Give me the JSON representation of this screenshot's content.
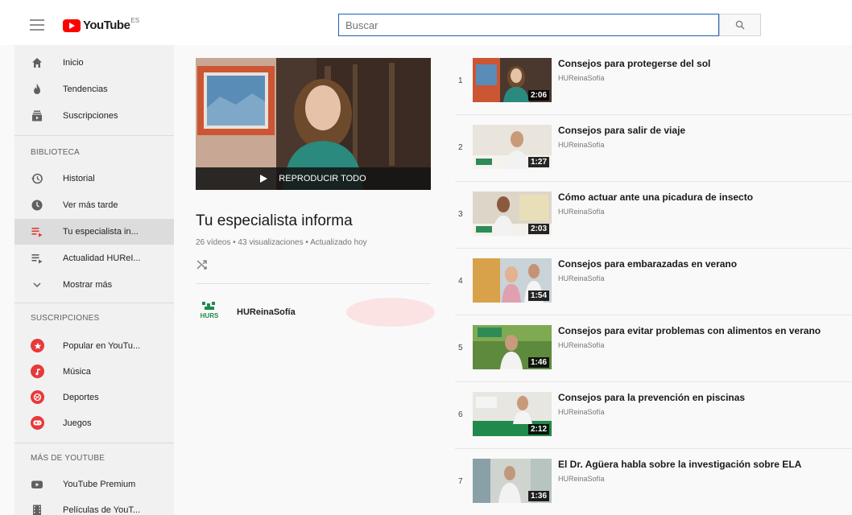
{
  "header": {
    "logo_text": "YouTube",
    "country": "ES",
    "search_placeholder": "Buscar"
  },
  "sidebar": {
    "main": [
      {
        "label": "Inicio",
        "icon": "home-icon"
      },
      {
        "label": "Tendencias",
        "icon": "flame-icon"
      },
      {
        "label": "Suscripciones",
        "icon": "subscriptions-icon"
      }
    ],
    "library_title": "BIBLIOTECA",
    "library": [
      {
        "label": "Historial",
        "icon": "history-icon"
      },
      {
        "label": "Ver más tarde",
        "icon": "clock-icon"
      },
      {
        "label": "Tu especialista in...",
        "icon": "playlist-icon",
        "active": true
      },
      {
        "label": "Actualidad HUReI...",
        "icon": "playlist-icon"
      },
      {
        "label": "Mostrar más",
        "icon": "chevron-down-icon"
      }
    ],
    "subs_title": "SUSCRIPCIONES",
    "subs": [
      {
        "label": "Popular en YouTu...",
        "icon": "star-icon"
      },
      {
        "label": "Música",
        "icon": "music-icon"
      },
      {
        "label": "Deportes",
        "icon": "sports-icon"
      },
      {
        "label": "Juegos",
        "icon": "gamepad-icon"
      }
    ],
    "more_title": "MÁS DE YOUTUBE",
    "more": [
      {
        "label": "YouTube Premium",
        "icon": "youtube-icon"
      },
      {
        "label": "Películas de YouT...",
        "icon": "film-icon"
      }
    ]
  },
  "playlist": {
    "play_all": "REPRODUCIR TODO",
    "title": "Tu especialista informa",
    "stats": "26 vídeos • 43 visualizaciones • Actualizado hoy",
    "owner": "HUReinaSofía",
    "owner_logo_text": "HURS"
  },
  "videos": [
    {
      "index": "1",
      "title": "Consejos para protegerse del sol",
      "channel": "HUReinaSofía",
      "duration": "2:06"
    },
    {
      "index": "2",
      "title": "Consejos para salir de viaje",
      "channel": "HUReinaSofía",
      "duration": "1:27"
    },
    {
      "index": "3",
      "title": "Cómo actuar ante una picadura de insecto",
      "channel": "HUReinaSofía",
      "duration": "2:03"
    },
    {
      "index": "4",
      "title": "Consejos para embarazadas en verano",
      "channel": "HUReinaSofía",
      "duration": "1:54"
    },
    {
      "index": "5",
      "title": "Consejos para evitar problemas con alimentos en verano",
      "channel": "HUReinaSofía",
      "duration": "1:46"
    },
    {
      "index": "6",
      "title": "Consejos para la prevención en piscinas",
      "channel": "HUReinaSofía",
      "duration": "2:12"
    },
    {
      "index": "7",
      "title": "El Dr. Agüera habla sobre la investigación sobre ELA",
      "channel": "HUReinaSofía",
      "duration": "1:36"
    }
  ],
  "colors": {
    "accent": "#ff0000",
    "search_border": "#1c62b9",
    "sidebar_bg": "#f1f1f1"
  }
}
